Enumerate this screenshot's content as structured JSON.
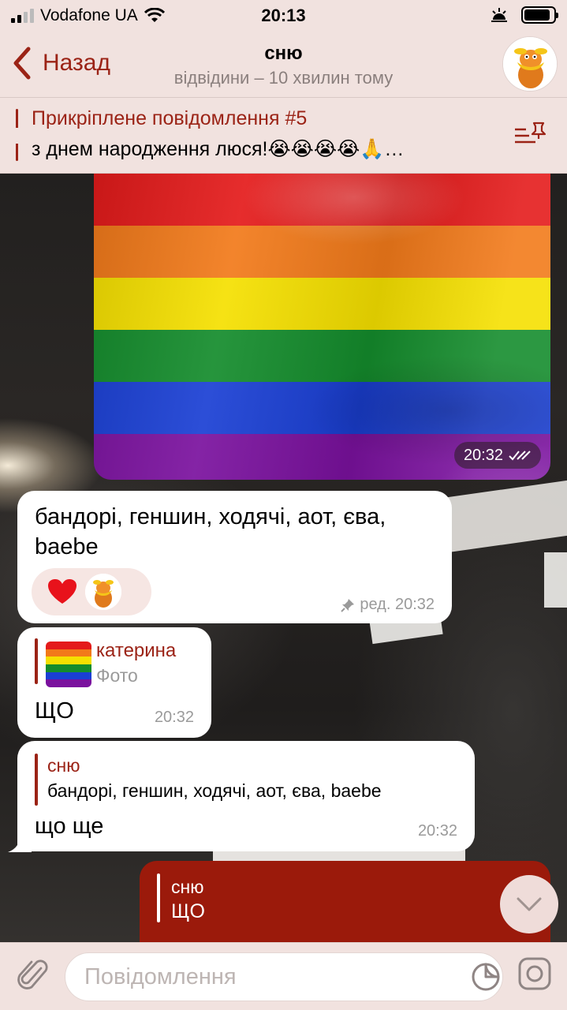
{
  "status_bar": {
    "carrier": "Vodafone UA",
    "time": "20:13",
    "battery_level": 0.9
  },
  "header": {
    "back_label": "Назад",
    "title": "сню",
    "subtitle": "відвідини – 10 хвилин тому"
  },
  "pinned": {
    "title": "Прикріплене повідомлення #5",
    "text": "з днем народження люся!😭😭😭😭🙏…"
  },
  "messages": {
    "photo": {
      "time": "20:32",
      "flag_colors": [
        "#e41b1b",
        "#f27a1a",
        "#f5e000",
        "#148c2c",
        "#1a3fd4",
        "#7a119e"
      ]
    },
    "m1": {
      "text": "бандорі, геншин, ходячі, аот, єва, baebe",
      "reaction": "❤️",
      "meta": "ред. 20:32"
    },
    "m2": {
      "reply_name": "катерина",
      "reply_type": "Фото",
      "text": "ЩО",
      "time": "20:32"
    },
    "m3": {
      "reply_name": "сню",
      "reply_text": "бандорі, геншин, ходячі, аот, єва, baebe",
      "text": "що ще",
      "time": "20:32"
    },
    "m4": {
      "reply_name": "сню",
      "reply_text": "ЩО"
    }
  },
  "input": {
    "placeholder": "Повідомлення"
  },
  "colors": {
    "accent": "#9b2316",
    "bar_bg": "#f1e2df",
    "outgoing": "#9b1a0b"
  }
}
